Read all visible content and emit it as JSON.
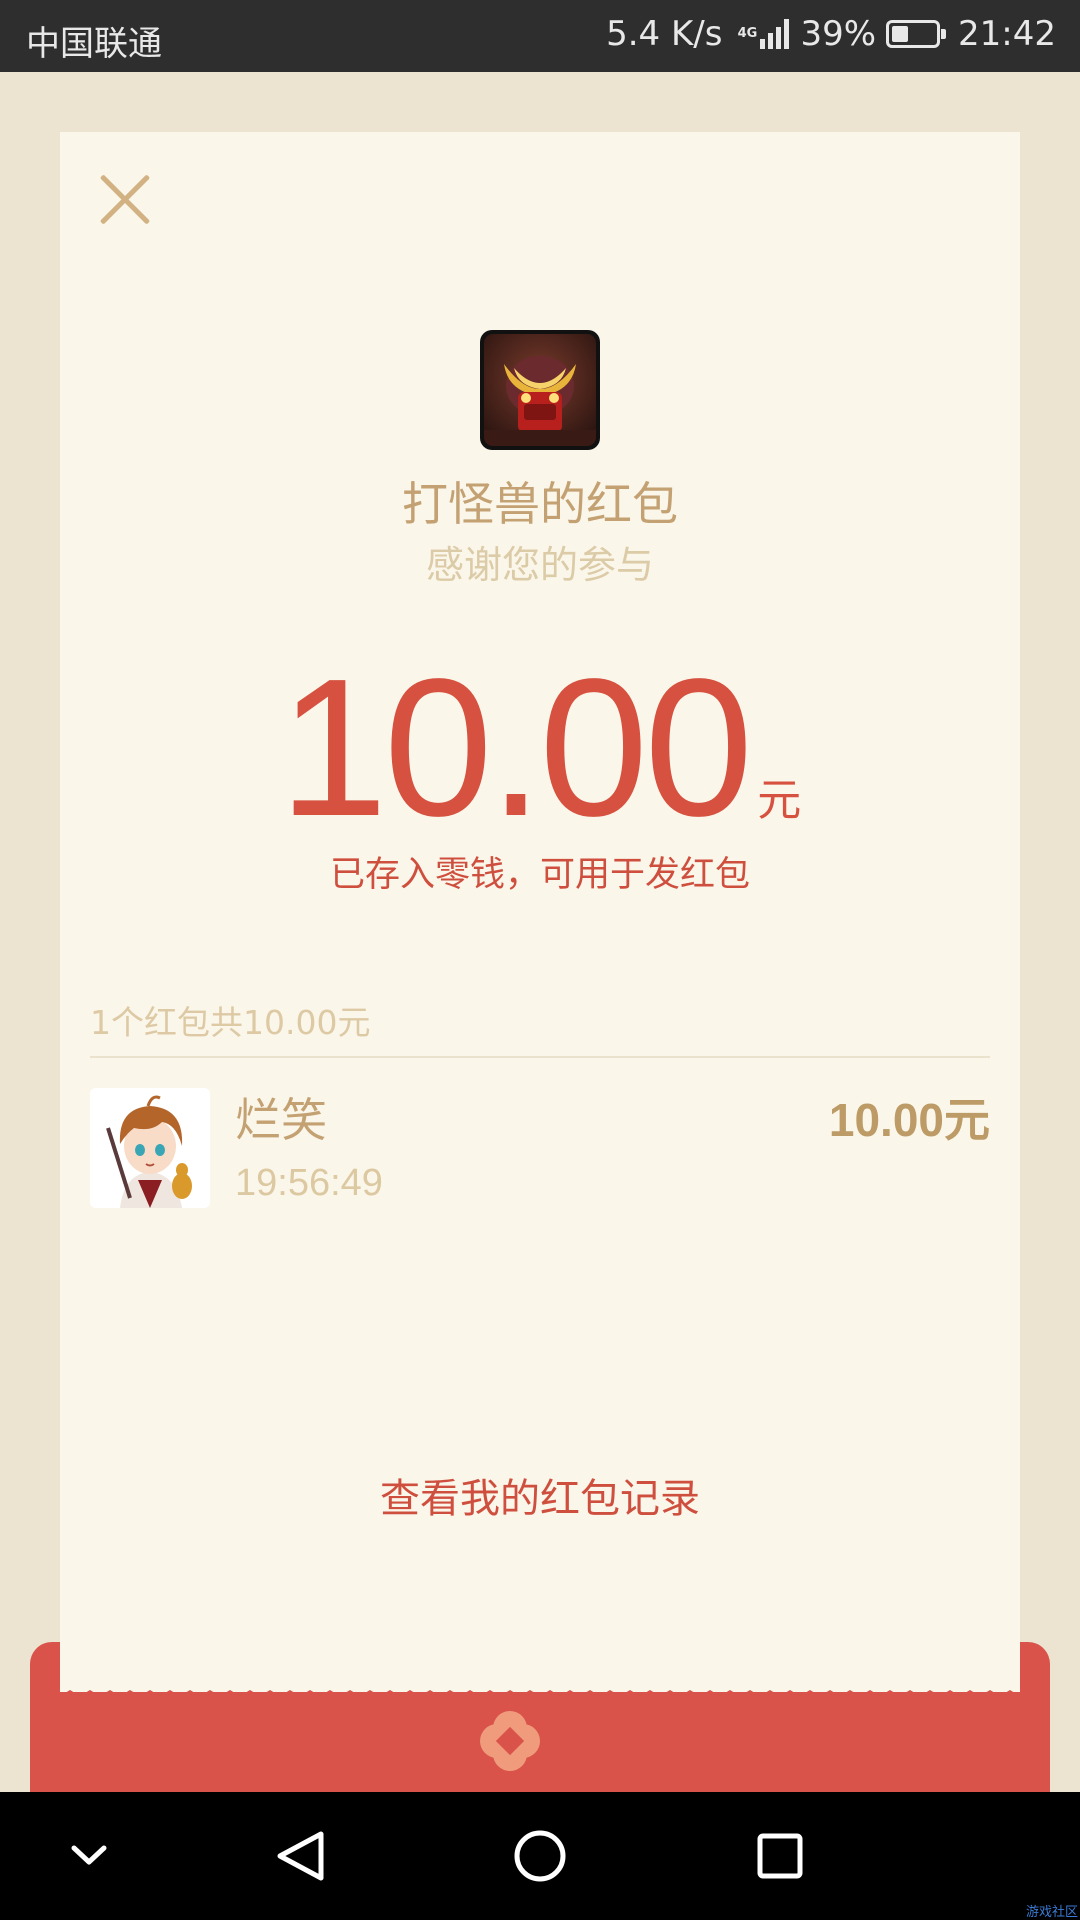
{
  "status_bar": {
    "carrier": "中国联通",
    "net_speed": "5.4 K/s",
    "network_type": "4G",
    "battery_percent": "39%",
    "battery_level": 0.39,
    "time": "21:42"
  },
  "card": {
    "sender_avatar_icon": "monster-avatar-icon",
    "title": "打怪兽的红包",
    "subtitle": "感谢您的参与",
    "amount": "10.00",
    "amount_unit": "元",
    "stored_note": "已存入零钱，可用于发红包",
    "summary": "1个红包共10.00元",
    "records": [
      {
        "name": "烂笑",
        "time": "19:56:49",
        "amount": "10.00元",
        "avatar_icon": "anime-boy-avatar-icon"
      }
    ],
    "history_link": "查看我的红包记录"
  },
  "colors": {
    "background": "#ece3d0",
    "card": "#fbf6ea",
    "accent_red": "#d6513f",
    "gold_text": "#c3a172",
    "envelope_red": "#d9534a"
  },
  "nav_bar": {
    "icons": [
      "chevron-down-icon",
      "back-icon",
      "home-icon",
      "recents-icon"
    ]
  },
  "watermark": "游戏社区"
}
